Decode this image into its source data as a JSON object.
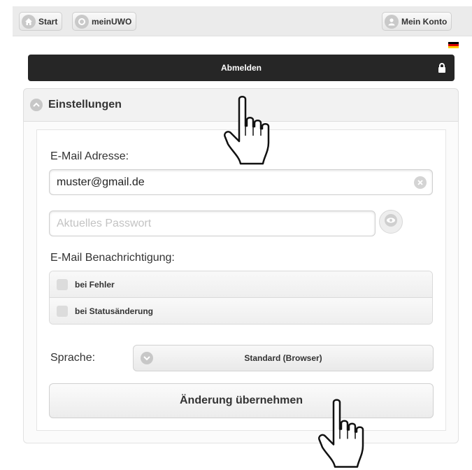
{
  "topbar": {
    "start_label": "Start",
    "meinuwo_label": "meinUWO",
    "account_label": "Mein Konto"
  },
  "flag": {
    "language": "de",
    "colors": [
      "#000000",
      "#dd0000",
      "#ffce00"
    ]
  },
  "logout": {
    "label": "Abmelden"
  },
  "settings": {
    "title": "Einstellungen",
    "email_label": "E-Mail Adresse:",
    "email_value": "muster@gmail.de",
    "password_placeholder": "Aktuelles Passwort",
    "notification_label": "E-Mail Benachrichtigung:",
    "notifications": [
      {
        "label": "bei Fehler",
        "checked": false
      },
      {
        "label": "bei Statusänderung",
        "checked": false
      }
    ],
    "language_label": "Sprache:",
    "language_value": "Standard (Browser)",
    "submit_label": "Änderung übernehmen"
  },
  "icons": [
    "home-icon",
    "uwo-icon",
    "user-icon",
    "lock-icon",
    "collapse-icon",
    "clear-icon",
    "eye-icon",
    "chevron-down-icon",
    "hand-cursor-icon"
  ],
  "colors": {
    "logout_bg": "#262626",
    "panel_bg": "#f2f2f2",
    "topbar_bg": "#ebebeb"
  }
}
